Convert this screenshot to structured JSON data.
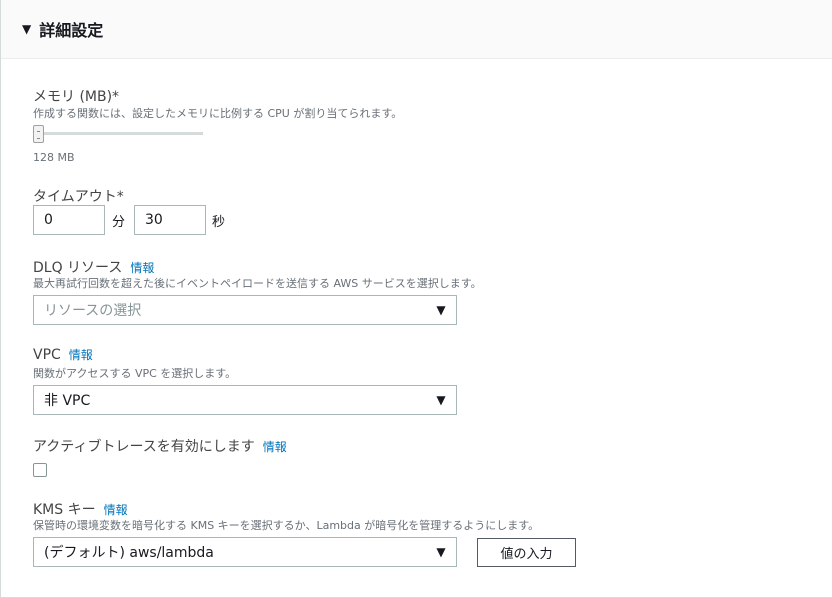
{
  "section": {
    "title": "詳細設定"
  },
  "memory": {
    "label": "メモリ (MB)*",
    "description": "作成する関数には、設定したメモリに比例する CPU が割り当てられます。",
    "value_text": "128 MB",
    "slider_fraction": 0.0
  },
  "timeout": {
    "label": "タイムアウト*",
    "minutes": "0",
    "minutes_unit": "分",
    "seconds": "30",
    "seconds_unit": "秒"
  },
  "dlq": {
    "label": "DLQ リソース",
    "info": "情報",
    "description": "最大再試行回数を超えた後にイベントペイロードを送信する AWS サービスを選択します。",
    "placeholder": "リソースの選択"
  },
  "vpc": {
    "label": "VPC",
    "info": "情報",
    "description": "関数がアクセスする VPC を選択します。",
    "selected": "非 VPC"
  },
  "tracing": {
    "label": "アクティブトレースを有効にします",
    "info": "情報",
    "checked": false
  },
  "kms": {
    "label": "KMS キー",
    "info": "情報",
    "description": "保管時の環境変数を暗号化する KMS キーを選択するか、Lambda が暗号化を管理するようにします。",
    "selected": "(デフォルト) aws/lambda",
    "enter_value_button": "値の入力"
  },
  "icons": {
    "caret": "caret-down-icon",
    "select_arrow": "triangle-down-icon"
  }
}
